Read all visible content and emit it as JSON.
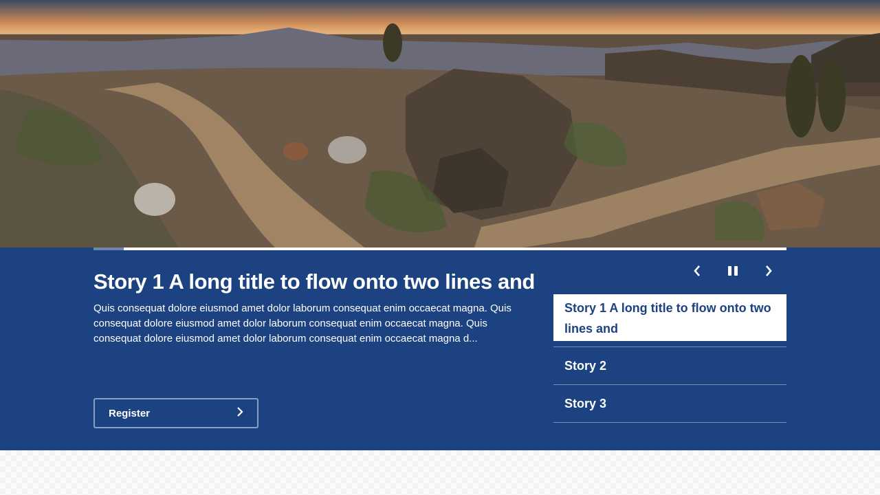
{
  "hero": {
    "image": "desert-trail-sunset-photo"
  },
  "carousel": {
    "progress": 0.044,
    "active_index": 0,
    "title": "Story 1 A long title to flow onto two lines and",
    "body": "Quis consequat dolore eiusmod amet dolor laborum consequat enim occaecat magna. Quis consequat dolore eiusmod amet dolor laborum consequat enim occaecat magna. Quis consequat dolore eiusmod amet dolor laborum consequat enim occaecat magna d...",
    "cta_label": "Register",
    "cta_icon": "chevron-right-icon",
    "controls": {
      "prev_icon": "chevron-left-icon",
      "pause_icon": "pause-icon",
      "next_icon": "chevron-right-icon"
    },
    "stories": [
      {
        "label": "Story 1 A long title to flow onto two lines and"
      },
      {
        "label": "Story 2"
      },
      {
        "label": "Story 3"
      }
    ]
  },
  "colors": {
    "panel": "#1c4282",
    "progress_fill": "#6f86ad",
    "progress_track": "#ffffff",
    "text_on_panel": "#ffffff"
  }
}
